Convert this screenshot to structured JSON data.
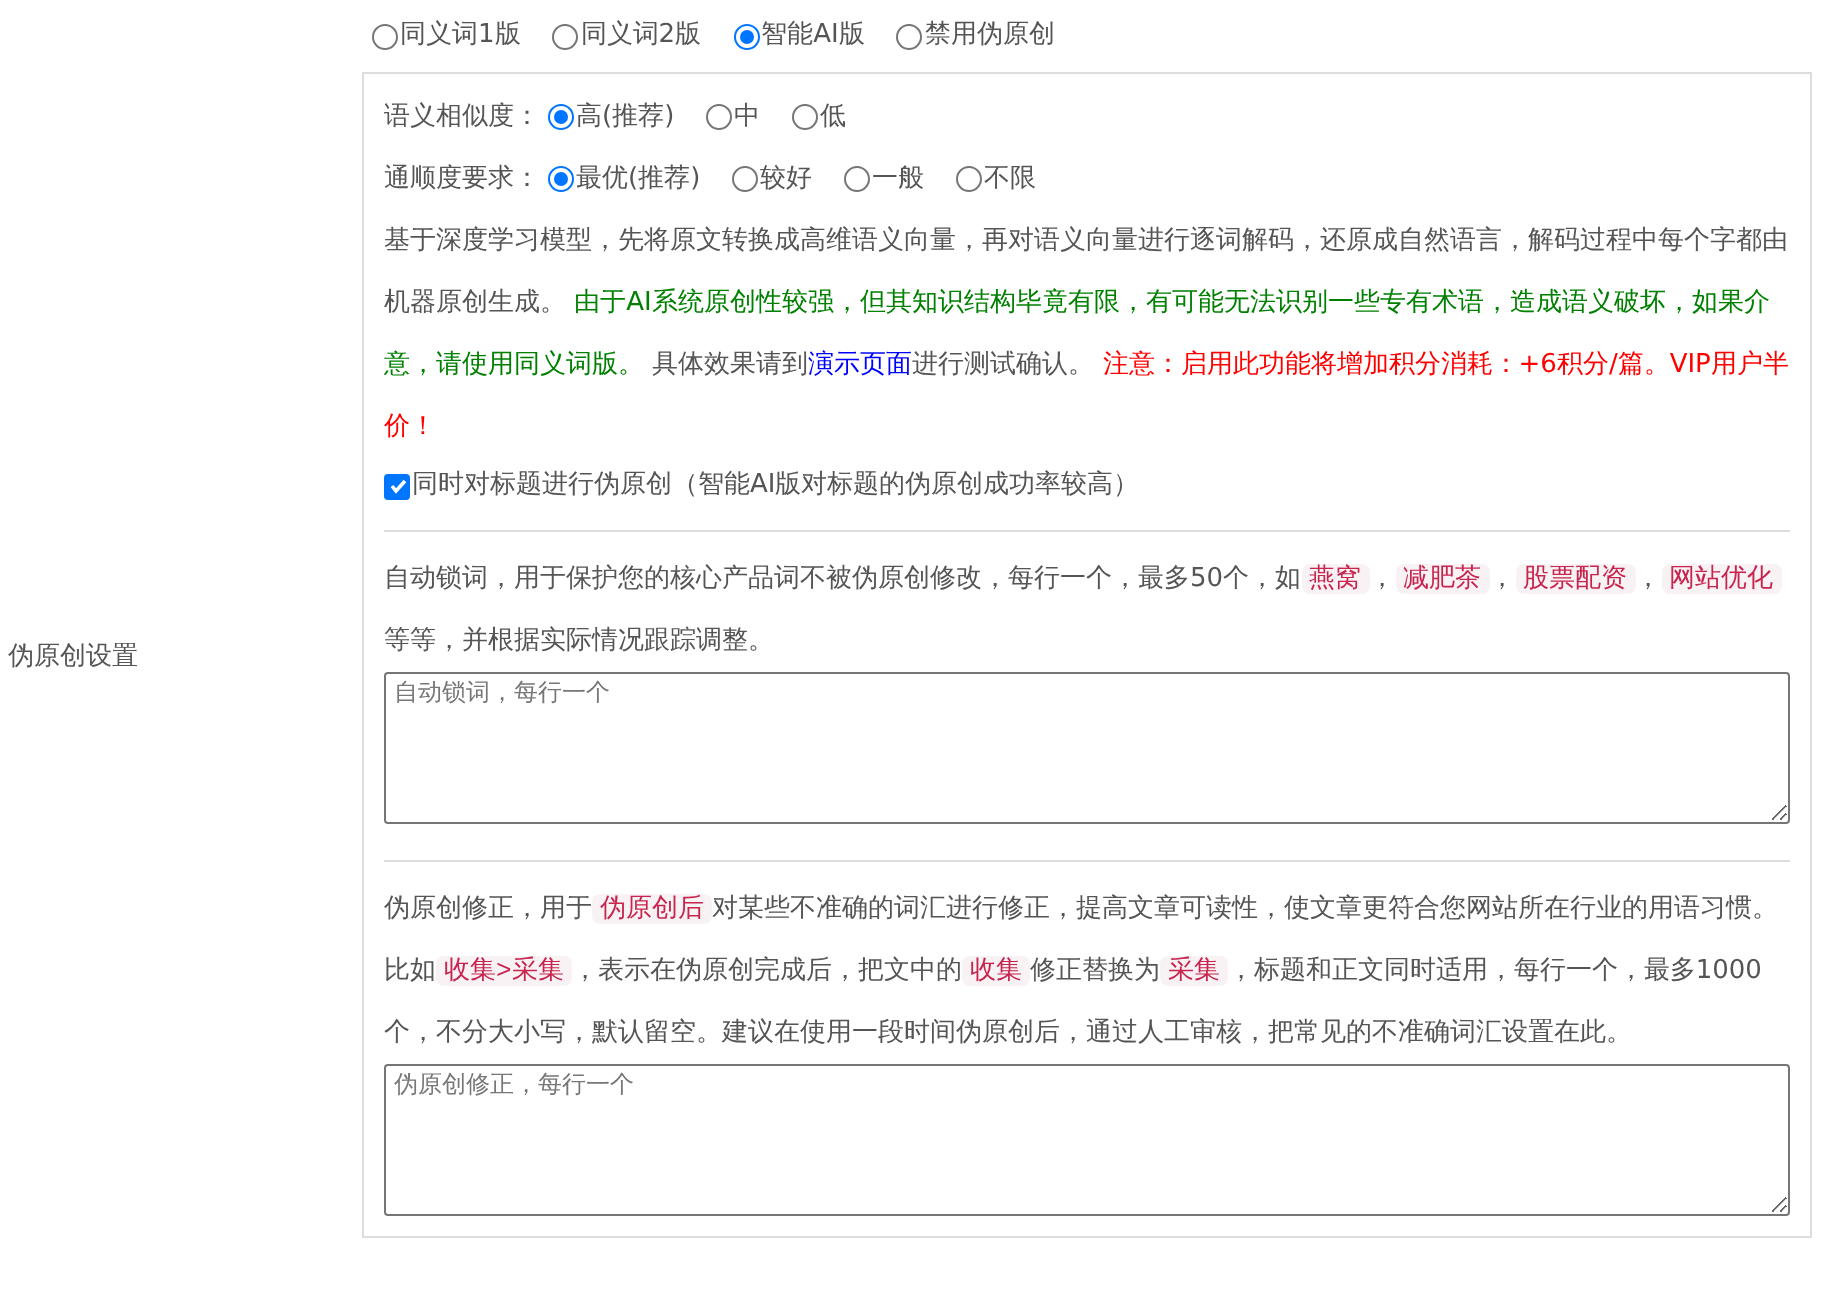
{
  "side_label": "伪原创设置",
  "modes": [
    {
      "label": "同义词1版",
      "selected": false
    },
    {
      "label": "同义词2版",
      "selected": false
    },
    {
      "label": "智能AI版",
      "selected": true
    },
    {
      "label": "禁用伪原创",
      "selected": false
    }
  ],
  "option_rows": [
    {
      "label": "语义相似度：",
      "options": [
        {
          "label": "高(推荐)",
          "selected": true
        },
        {
          "label": "中",
          "selected": false
        },
        {
          "label": "低",
          "selected": false
        }
      ]
    },
    {
      "label": "通顺度要求：",
      "options": [
        {
          "label": "最优(推荐)",
          "selected": true
        },
        {
          "label": "较好",
          "selected": false
        },
        {
          "label": "一般",
          "selected": false
        },
        {
          "label": "不限",
          "selected": false
        }
      ]
    }
  ],
  "ai_description": [
    {
      "kind": "text",
      "text": "基于深度学习模型，先将原文转换成高维语义向量，再对语义向量进行逐词解码，还原成自然语言，解码过程中每个字都由机器原创生成。 "
    },
    {
      "kind": "green",
      "text": "由于AI系统原创性较强，但其知识结构毕竟有限，有可能无法识别一些专有术语，造成语义破坏，如果介意，请使用同义词版。"
    },
    {
      "kind": "text",
      "text": " 具体效果请到"
    },
    {
      "kind": "link",
      "text": "演示页面"
    },
    {
      "kind": "text",
      "text": "进行测试确认。 "
    },
    {
      "kind": "red",
      "text": "注意：启用此功能将增加积分消耗：+6积分/篇。VIP用户半价！"
    }
  ],
  "title_checkbox": {
    "label": "同时对标题进行伪原创（智能AI版对标题的伪原创成功率较高）",
    "checked": true
  },
  "lock_words": {
    "description": [
      {
        "kind": "text",
        "text": "自动锁词，用于保护您的核心产品词不被伪原创修改，每行一个，最多50个，如"
      },
      {
        "kind": "code",
        "text": "燕窝"
      },
      {
        "kind": "text",
        "text": "，"
      },
      {
        "kind": "code",
        "text": "减肥茶"
      },
      {
        "kind": "text",
        "text": "，"
      },
      {
        "kind": "code",
        "text": "股票配资"
      },
      {
        "kind": "text",
        "text": "，"
      },
      {
        "kind": "code",
        "text": "网站优化"
      },
      {
        "kind": "text",
        "text": " 等等，并根据实际情况跟踪调整。"
      }
    ],
    "placeholder": "自动锁词，每行一个"
  },
  "corrections": {
    "description": [
      {
        "kind": "text",
        "text": "伪原创修正，用于"
      },
      {
        "kind": "code",
        "text": "伪原创后"
      },
      {
        "kind": "text",
        "text": "对某些不准确的词汇进行修正，提高文章可读性，使文章更符合您网站所在行业的用语习惯。比如"
      },
      {
        "kind": "code",
        "text": "收集>采集"
      },
      {
        "kind": "text",
        "text": "，表示在伪原创完成后，把文中的"
      },
      {
        "kind": "code",
        "text": "收集"
      },
      {
        "kind": "text",
        "text": "修正替换为"
      },
      {
        "kind": "code",
        "text": "采集"
      },
      {
        "kind": "text",
        "text": "，标题和正文同时适用，每行一个，最多1000个，不分大小写，默认留空。建议在使用一段时间伪原创后，通过人工审核，把常见的不准确词汇设置在此。"
      }
    ],
    "placeholder": "伪原创修正，每行一个"
  }
}
